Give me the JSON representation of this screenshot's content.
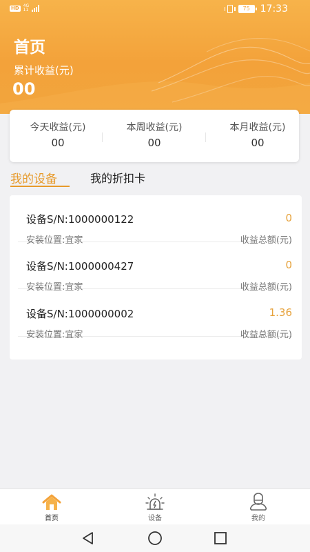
{
  "status_bar": {
    "hd": "HD",
    "network_top": "4G",
    "network_bottom": "11",
    "battery": "75",
    "time": "17:33"
  },
  "header": {
    "title": "首页",
    "earnings_label": "累计收益(元)",
    "earnings_value": "00"
  },
  "stats": [
    {
      "label": "今天收益(元)",
      "value": "00"
    },
    {
      "label": "本周收益(元)",
      "value": "00"
    },
    {
      "label": "本月收益(元)",
      "value": "00"
    }
  ],
  "tabs": {
    "devices": "我的设备",
    "cards": "我的折扣卡",
    "active": "devices"
  },
  "devices": [
    {
      "sn": "设备S/N:1000000122",
      "earnings": "0",
      "location": "安装位置:宜家",
      "total_label": "收益总额(元)"
    },
    {
      "sn": "设备S/N:1000000427",
      "earnings": "0",
      "location": "安装位置:宜家",
      "total_label": "收益总额(元)"
    },
    {
      "sn": "设备S/N:1000000002",
      "earnings": "1.36",
      "location": "安装位置:宜家",
      "total_label": "收益总额(元)"
    }
  ],
  "tabbar": {
    "items": [
      {
        "label": "首页",
        "icon": "home-icon"
      },
      {
        "label": "设备",
        "icon": "device-icon"
      },
      {
        "label": "我的",
        "icon": "profile-icon"
      }
    ],
    "active_index": 0
  },
  "nav_bar": {
    "buttons": [
      "back-icon",
      "home-circle-icon",
      "recents-icon"
    ]
  },
  "colors": {
    "header_orange": "#f3a23a",
    "accent": "#e79a2b",
    "earnings_text": "#e6a23c"
  }
}
